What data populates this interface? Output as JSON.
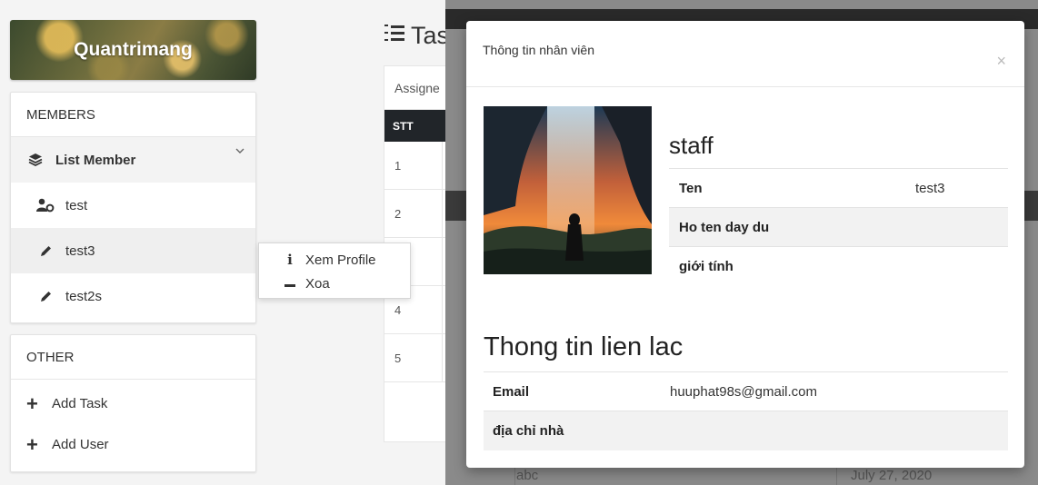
{
  "sidebar": {
    "brand": "Quantrimang",
    "members": {
      "heading": "MEMBERS",
      "list_label": "List Member",
      "items": [
        {
          "label": "test"
        },
        {
          "label": "test3"
        },
        {
          "label": "test2s"
        }
      ]
    },
    "other": {
      "heading": "OTHER",
      "items": [
        {
          "label": "Add Task"
        },
        {
          "label": "Add User"
        }
      ]
    }
  },
  "context_menu": {
    "items": [
      {
        "icon": "info-icon",
        "label": "Xem Profile"
      },
      {
        "icon": "minus-icon",
        "label": "Xoa"
      }
    ]
  },
  "background_page": {
    "title": "Tas",
    "tab": "Assigne",
    "column_header": "STT",
    "rows": [
      "1",
      "2",
      "",
      "4",
      "5"
    ],
    "under_cell": "abc",
    "under_date": "July 27, 2020"
  },
  "modal": {
    "title": "Thông tin nhân viên",
    "close": "×",
    "role": "staff",
    "details": [
      {
        "key": "Ten",
        "value": "test3"
      },
      {
        "key": "Ho ten day du",
        "value": ""
      },
      {
        "key": "giới tính",
        "value": ""
      }
    ],
    "contact_title": "Thong tin lien lac",
    "contact": [
      {
        "key": "Email",
        "value": "huuphat98s@gmail.com"
      },
      {
        "key": "địa chỉ nhà",
        "value": ""
      }
    ]
  }
}
